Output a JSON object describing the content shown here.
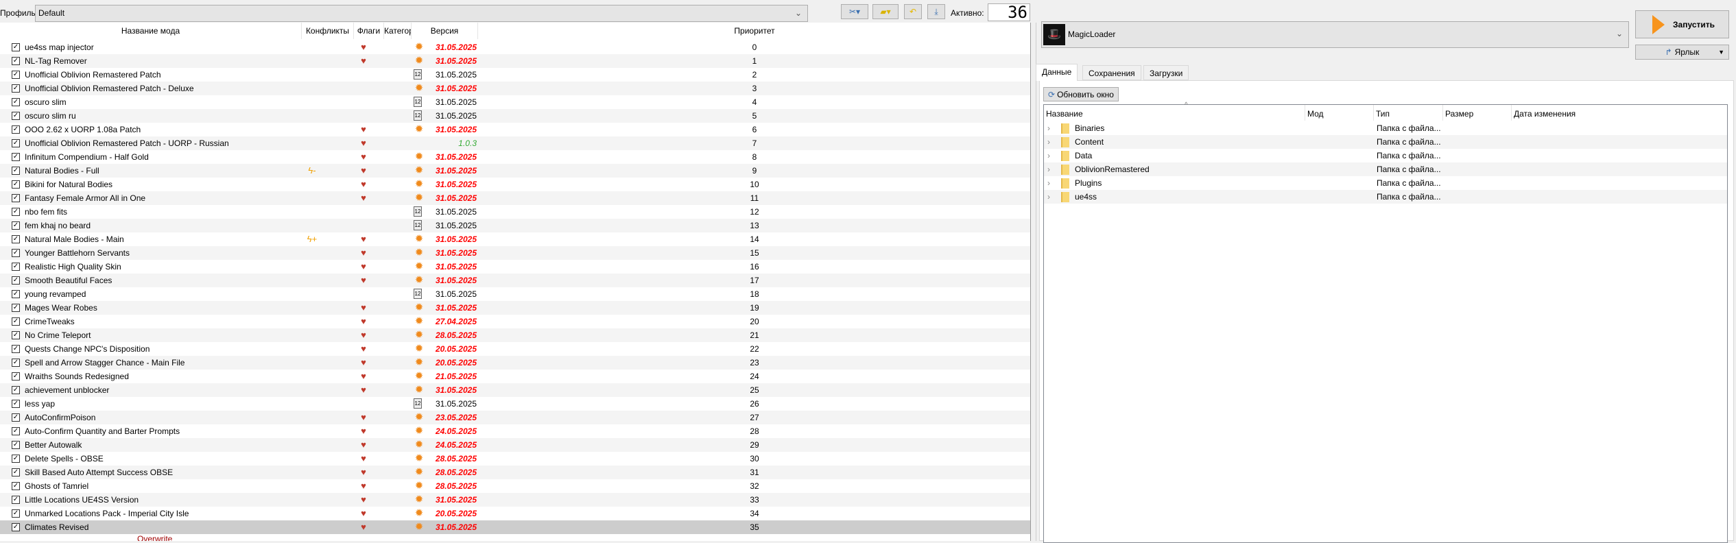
{
  "toolbar": {
    "profile_label": "Профиль",
    "profile_value": "Default",
    "active_label": "Активно:",
    "active_count": "36"
  },
  "modlist": {
    "headers": [
      "Название мода",
      "Конфликты",
      "Флаги",
      "Категор",
      "Версия",
      "Приоритет"
    ],
    "rows": [
      {
        "name": "ue4ss map injector",
        "conflict": "",
        "flag": true,
        "cat": "star",
        "version": "31.05.2025",
        "vstyle": "new",
        "priority": "0"
      },
      {
        "name": "NL-Tag Remover",
        "conflict": "",
        "flag": true,
        "cat": "star",
        "version": "31.05.2025",
        "vstyle": "new",
        "priority": "1"
      },
      {
        "name": "Unofficial Oblivion Remastered Patch",
        "conflict": "",
        "flag": false,
        "cat": "calendar",
        "version": "31.05.2025",
        "vstyle": "plain",
        "priority": "2"
      },
      {
        "name": "Unofficial Oblivion Remastered Patch - Deluxe",
        "conflict": "",
        "flag": false,
        "cat": "star",
        "version": "31.05.2025",
        "vstyle": "new",
        "priority": "3"
      },
      {
        "name": "oscuro slim",
        "conflict": "",
        "flag": false,
        "cat": "calendar",
        "version": "31.05.2025",
        "vstyle": "plain",
        "priority": "4"
      },
      {
        "name": "oscuro slim ru",
        "conflict": "",
        "flag": false,
        "cat": "calendar",
        "version": "31.05.2025",
        "vstyle": "plain",
        "priority": "5"
      },
      {
        "name": "OOO 2.62 x UORP 1.08a Patch",
        "conflict": "",
        "flag": true,
        "cat": "star",
        "version": "31.05.2025",
        "vstyle": "new",
        "priority": "6"
      },
      {
        "name": "Unofficial Oblivion Remastered Patch - UORP - Russian",
        "conflict": "",
        "flag": true,
        "cat": "",
        "version": "1.0.3",
        "vstyle": "green",
        "priority": "7"
      },
      {
        "name": "Infinitum Compendium - Half Gold",
        "conflict": "",
        "flag": true,
        "cat": "star",
        "version": "31.05.2025",
        "vstyle": "new",
        "priority": "8"
      },
      {
        "name": "Natural Bodies - Full",
        "conflict": "minus",
        "flag": true,
        "cat": "star",
        "version": "31.05.2025",
        "vstyle": "new",
        "priority": "9"
      },
      {
        "name": "Bikini for Natural Bodies",
        "conflict": "",
        "flag": true,
        "cat": "star",
        "version": "31.05.2025",
        "vstyle": "new",
        "priority": "10"
      },
      {
        "name": "Fantasy Female Armor All in One",
        "conflict": "",
        "flag": true,
        "cat": "star",
        "version": "31.05.2025",
        "vstyle": "new",
        "priority": "11"
      },
      {
        "name": "nbo fem fits",
        "conflict": "",
        "flag": false,
        "cat": "calendar",
        "version": "31.05.2025",
        "vstyle": "plain",
        "priority": "12"
      },
      {
        "name": "fem khaj no beard",
        "conflict": "",
        "flag": false,
        "cat": "calendar",
        "version": "31.05.2025",
        "vstyle": "plain",
        "priority": "13"
      },
      {
        "name": "Natural Male Bodies - Main",
        "conflict": "plus",
        "flag": true,
        "cat": "star",
        "version": "31.05.2025",
        "vstyle": "new",
        "priority": "14"
      },
      {
        "name": "Younger Battlehorn Servants",
        "conflict": "",
        "flag": true,
        "cat": "star",
        "version": "31.05.2025",
        "vstyle": "new",
        "priority": "15"
      },
      {
        "name": "Realistic High Quality Skin",
        "conflict": "",
        "flag": true,
        "cat": "star",
        "version": "31.05.2025",
        "vstyle": "new",
        "priority": "16"
      },
      {
        "name": "Smooth Beautiful Faces",
        "conflict": "",
        "flag": true,
        "cat": "star",
        "version": "31.05.2025",
        "vstyle": "new",
        "priority": "17"
      },
      {
        "name": "young revamped",
        "conflict": "",
        "flag": false,
        "cat": "calendar",
        "version": "31.05.2025",
        "vstyle": "plain",
        "priority": "18"
      },
      {
        "name": "Mages Wear Robes",
        "conflict": "",
        "flag": true,
        "cat": "star",
        "version": "31.05.2025",
        "vstyle": "new",
        "priority": "19"
      },
      {
        "name": "CrimeTweaks",
        "conflict": "",
        "flag": true,
        "cat": "star",
        "version": "27.04.2025",
        "vstyle": "new",
        "priority": "20"
      },
      {
        "name": "No Crime Teleport",
        "conflict": "",
        "flag": true,
        "cat": "star",
        "version": "28.05.2025",
        "vstyle": "new",
        "priority": "21"
      },
      {
        "name": "Quests Change NPC's Disposition",
        "conflict": "",
        "flag": true,
        "cat": "star",
        "version": "20.05.2025",
        "vstyle": "new",
        "priority": "22"
      },
      {
        "name": "Spell and Arrow Stagger Chance - Main File",
        "conflict": "",
        "flag": true,
        "cat": "star",
        "version": "20.05.2025",
        "vstyle": "new",
        "priority": "23"
      },
      {
        "name": "Wraiths Sounds Redesigned",
        "conflict": "",
        "flag": true,
        "cat": "star",
        "version": "21.05.2025",
        "vstyle": "new",
        "priority": "24"
      },
      {
        "name": "achievement unblocker",
        "conflict": "",
        "flag": true,
        "cat": "star",
        "version": "31.05.2025",
        "vstyle": "new",
        "priority": "25"
      },
      {
        "name": "less yap",
        "conflict": "",
        "flag": false,
        "cat": "calendar",
        "version": "31.05.2025",
        "vstyle": "plain",
        "priority": "26"
      },
      {
        "name": "AutoConfirmPoison",
        "conflict": "",
        "flag": true,
        "cat": "star",
        "version": "23.05.2025",
        "vstyle": "new",
        "priority": "27"
      },
      {
        "name": "Auto-Confirm Quantity and Barter Prompts",
        "conflict": "",
        "flag": true,
        "cat": "star",
        "version": "24.05.2025",
        "vstyle": "new",
        "priority": "28"
      },
      {
        "name": "Better Autowalk",
        "conflict": "",
        "flag": true,
        "cat": "star",
        "version": "24.05.2025",
        "vstyle": "new",
        "priority": "29"
      },
      {
        "name": "Delete Spells - OBSE",
        "conflict": "",
        "flag": true,
        "cat": "star",
        "version": "28.05.2025",
        "vstyle": "new",
        "priority": "30"
      },
      {
        "name": "Skill Based Auto Attempt Success OBSE",
        "conflict": "",
        "flag": true,
        "cat": "star",
        "version": "28.05.2025",
        "vstyle": "new",
        "priority": "31"
      },
      {
        "name": "Ghosts of Tamriel",
        "conflict": "",
        "flag": true,
        "cat": "star",
        "version": "28.05.2025",
        "vstyle": "new",
        "priority": "32"
      },
      {
        "name": "Little Locations UE4SS Version",
        "conflict": "",
        "flag": true,
        "cat": "star",
        "version": "31.05.2025",
        "vstyle": "new",
        "priority": "33"
      },
      {
        "name": "Unmarked Locations Pack - Imperial City Isle",
        "conflict": "",
        "flag": true,
        "cat": "star",
        "version": "20.05.2025",
        "vstyle": "new",
        "priority": "34"
      },
      {
        "name": "Climates Revised",
        "conflict": "",
        "flag": true,
        "cat": "star",
        "version": "31.05.2025",
        "vstyle": "new",
        "priority": "35",
        "selected": true
      }
    ],
    "overwrite": "Overwrite"
  },
  "right": {
    "executable": "MagicLoader",
    "run_label": "Запустить",
    "shortcut_label": "Ярлык",
    "tabs": [
      "Данные",
      "Сохранения",
      "Загрузки"
    ],
    "refresh_label": "Обновить окно",
    "tree_headers": [
      "Название",
      "Мод",
      "Тип",
      "Размер",
      "Дата изменения"
    ],
    "tree_rows": [
      {
        "name": "Binaries",
        "type": "Папка с файла..."
      },
      {
        "name": "Content",
        "type": "Папка с файла..."
      },
      {
        "name": "Data",
        "type": "Папка с файла..."
      },
      {
        "name": "OblivionRemastered",
        "type": "Папка с файла..."
      },
      {
        "name": "Plugins",
        "type": "Папка с файла..."
      },
      {
        "name": "ue4ss",
        "type": "Папка с файла..."
      }
    ]
  },
  "colors": {
    "new_version": "#ff0000",
    "green_version": "#33aa33",
    "selected_row": "#cdcdcd",
    "run_arrow": "#f7941d"
  }
}
